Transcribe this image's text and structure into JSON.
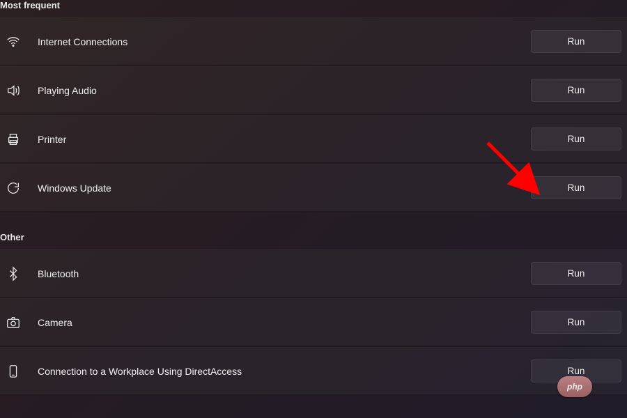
{
  "sections": [
    {
      "id": "most-frequent",
      "header": "Most frequent",
      "items": [
        {
          "id": "internet-connections",
          "icon": "wifi",
          "label": "Internet Connections",
          "button": "Run"
        },
        {
          "id": "playing-audio",
          "icon": "audio",
          "label": "Playing Audio",
          "button": "Run"
        },
        {
          "id": "printer",
          "icon": "printer",
          "label": "Printer",
          "button": "Run"
        },
        {
          "id": "windows-update",
          "icon": "update",
          "label": "Windows Update",
          "button": "Run"
        }
      ]
    },
    {
      "id": "other",
      "header": "Other",
      "items": [
        {
          "id": "bluetooth",
          "icon": "bluetooth",
          "label": "Bluetooth",
          "button": "Run"
        },
        {
          "id": "camera",
          "icon": "camera",
          "label": "Camera",
          "button": "Run"
        },
        {
          "id": "direct-access",
          "icon": "phone",
          "label": "Connection to a Workplace Using DirectAccess",
          "button": "Run"
        }
      ]
    }
  ],
  "annotation": {
    "color": "#ff0000"
  },
  "watermark": {
    "text": "php"
  }
}
